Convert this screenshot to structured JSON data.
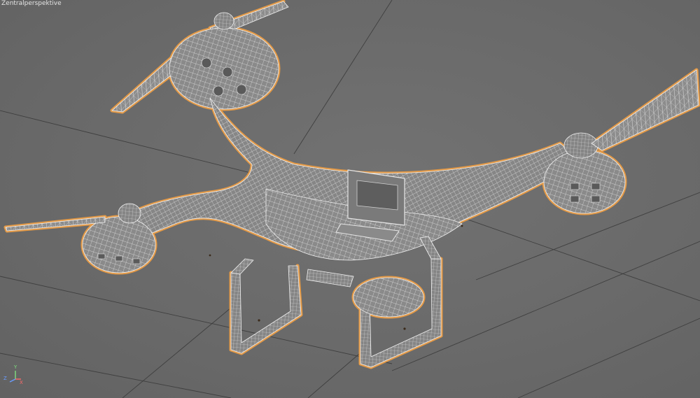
{
  "viewport": {
    "label": "Zentralperspektive"
  },
  "scene": {
    "object": "drone-wireframe",
    "wire_color": "#d9d9d9",
    "selection_outline_color": "#e39a48",
    "grid_color": "#3e3e3e",
    "background_color": "#6b6b6b"
  },
  "axis": {
    "y_label": "Y",
    "z_label": "Z",
    "x_label": "X",
    "y_color": "#7ee07e",
    "z_color": "#6a9cff",
    "x_color": "#ff6a6a"
  }
}
